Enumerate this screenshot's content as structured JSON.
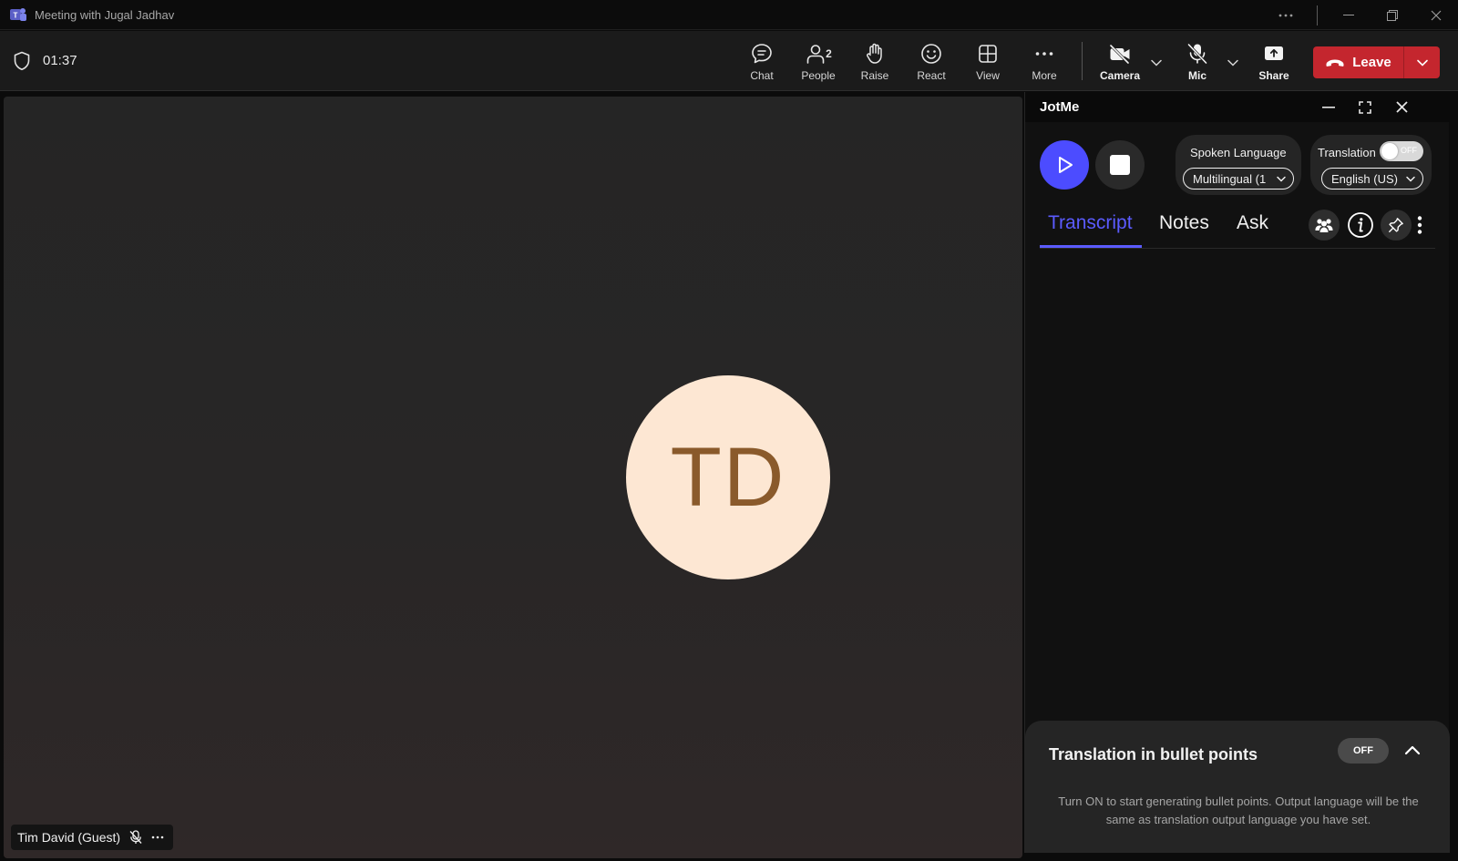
{
  "window": {
    "title": "Meeting with Jugal Jadhav"
  },
  "toolbar": {
    "timer": "01:37",
    "chat_label": "Chat",
    "people_label": "People",
    "people_count": "2",
    "raise_label": "Raise",
    "react_label": "React",
    "view_label": "View",
    "more_label": "More",
    "camera_label": "Camera",
    "mic_label": "Mic",
    "share_label": "Share",
    "leave_label": "Leave",
    "leave_color": "#c4262e"
  },
  "stage": {
    "avatar_initials": "TD",
    "participant_name": "Tim David (Guest)"
  },
  "jotme": {
    "title": "JotMe",
    "play_color": "#4c4cff",
    "spoken_language_label": "Spoken Language",
    "spoken_language_value": "Multilingual (1",
    "translation_label": "Translation",
    "translation_toggle": "OFF",
    "translation_language_value": "English (US)",
    "tabs": [
      {
        "label": "Transcript",
        "active": true
      },
      {
        "label": "Notes",
        "active": false
      },
      {
        "label": "Ask",
        "active": false
      }
    ],
    "accent_color": "#5b5bff",
    "bullet_points": {
      "title": "Translation in bullet points",
      "toggle": "OFF",
      "description": "Turn ON to start generating bullet points. Output language will be the same as translation output language you have set."
    }
  }
}
